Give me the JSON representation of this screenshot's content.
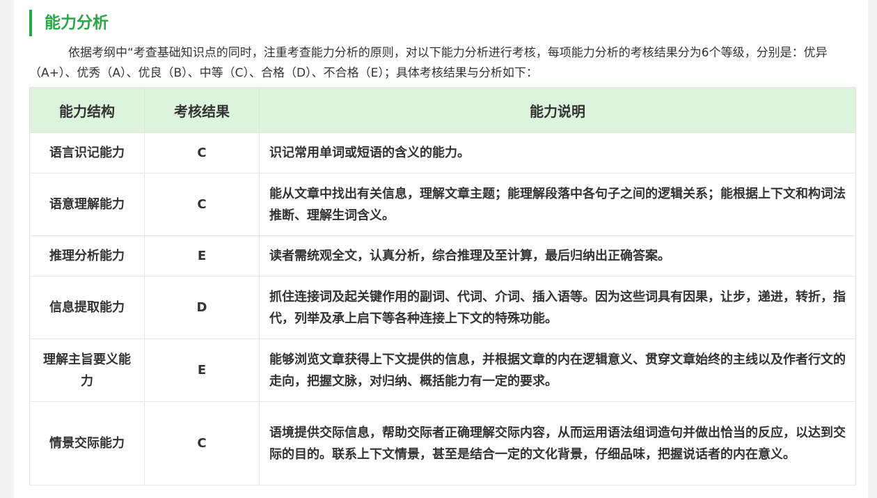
{
  "section": {
    "title": "能力分析",
    "intro": "依据考纲中“考查基础知识点的同时，注重考查能力分析的原则，对以下能力分析进行考核，每项能力分析的考核结果分为6个等级，分别是：优异（A+）、优秀（A）、优良（B）、中等（C）、合格（D）、不合格（E）；具体考核结果与分析如下："
  },
  "table": {
    "headers": [
      "能力结构",
      "考核结果",
      "能力说明"
    ],
    "rows": [
      {
        "structure": "语言识记能力",
        "result": "C",
        "desc": "识记常用单词或短语的含义的能力。"
      },
      {
        "structure": "语意理解能力",
        "result": "C",
        "desc": "能从文章中找出有关信息，理解文章主题；能理解段落中各句子之间的逻辑关系；能根据上下文和构词法推断、理解生词含义。"
      },
      {
        "structure": "推理分析能力",
        "result": "E",
        "desc": "读者需统观全文，认真分析，综合推理及至计算，最后归纳出正确答案。"
      },
      {
        "structure": "信息提取能力",
        "result": "D",
        "desc": "抓住连接词及起关键作用的副词、代词、介词、插入语等。因为这些词具有因果，让步，递进，转折，指代，列举及承上启下等各种连接上下文的特殊功能。"
      },
      {
        "structure": "理解主旨要义能力",
        "result": "E",
        "desc": "能够浏览文章获得上下文提供的信息，并根据文章的内在逻辑意义、贯穿文章始终的主线以及作者行文的走向，把握文脉，对归纳、概括能力有一定的要求。"
      },
      {
        "structure": "情景交际能力",
        "result": "C",
        "desc": "语境提供交际信息，帮助交际者正确理解交际内容，从而运用语法组词造句并做出恰当的反应，以达到交际的目的。联系上下文情景，甚至是结合一定的文化背景，仔细品味，把握说话者的内在意义。"
      }
    ]
  },
  "colors": {
    "accent": "#2aa748",
    "header_bg": "#dcf3dc"
  }
}
